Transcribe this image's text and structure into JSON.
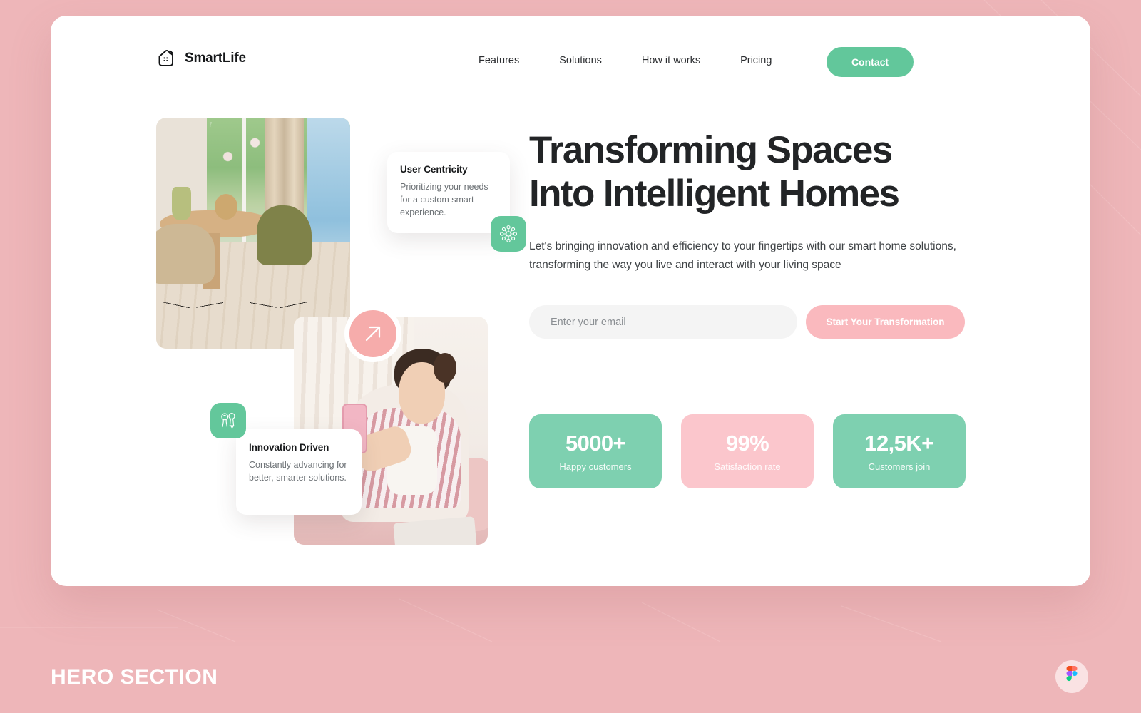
{
  "brand": {
    "name": "SmartLife",
    "logo_icon": "smart-home-icon"
  },
  "nav": {
    "items": [
      {
        "label": "Features"
      },
      {
        "label": "Solutions"
      },
      {
        "label": "How it works"
      },
      {
        "label": "Pricing"
      }
    ],
    "cta": {
      "label": "Contact",
      "color": "#62c79b"
    }
  },
  "hero": {
    "title": "Transforming Spaces\nInto Intelligent Homes",
    "subtitle": "Let's bringing innovation and efficiency to your fingertips with our smart home solutions, transforming the way you live and interact with your living space",
    "form": {
      "email_placeholder": "Enter your email",
      "email_value": "",
      "submit_label": "Start Your Transformation",
      "submit_color": "#fab9be"
    }
  },
  "stats": [
    {
      "value": "5000+",
      "label": "Happy customers",
      "color": "#7ed0b0"
    },
    {
      "value": "99%",
      "label": "Satisfaction rate",
      "color": "#fbc6cc"
    },
    {
      "value": "12,5K+",
      "label": "Customers join",
      "color": "#7ed0b0"
    }
  ],
  "feature_cards": [
    {
      "title": "User Centricity",
      "body": "Prioritizing your needs for a custom smart experience.",
      "icon": "network-nodes-icon",
      "icon_bg": "#63c79b"
    },
    {
      "title": "Innovation Driven",
      "body": "Constantly advancing for better, smarter solutions.",
      "icon": "innovation-bulb-icon",
      "icon_bg": "#63c79b"
    }
  ],
  "decor": {
    "arrow_bubble_icon": "arrow-up-right-icon",
    "arrow_bubble_color": "#f6acab"
  },
  "footer": {
    "label": "HERO SECTION",
    "badge_icon": "figma-icon"
  },
  "theme": {
    "page_background": "#eeb6b9",
    "card_background": "#ffffff",
    "accent_green": "#62c79b",
    "accent_pink": "#fab9be",
    "text_dark": "#222426"
  }
}
